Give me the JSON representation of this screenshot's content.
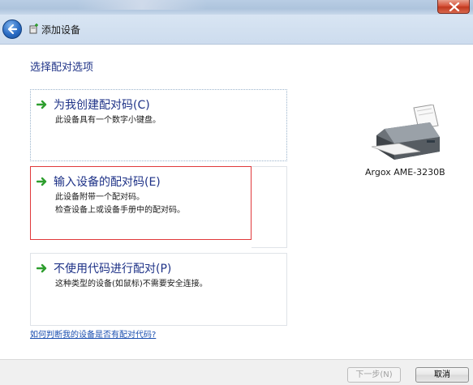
{
  "window": {
    "header_title": "添加设备"
  },
  "content": {
    "section_title": "选择配对选项",
    "options": [
      {
        "title": "为我创建配对码(C)",
        "desc_lines": [
          "此设备具有一个数字小键盘。"
        ]
      },
      {
        "title": "输入设备的配对码(E)",
        "desc_lines": [
          "此设备附带一个配对码。",
          "检查设备上或设备手册中的配对码。"
        ]
      },
      {
        "title": "不使用代码进行配对(P)",
        "desc_lines": [
          "这种类型的设备(如鼠标)不需要安全连接。"
        ]
      }
    ],
    "help_link": "如何判断我的设备是否有配对代码?"
  },
  "device": {
    "name": "Argox AME-3230B",
    "icon": "printer-icon"
  },
  "footer": {
    "next_label": "下一步(N)",
    "cancel_label": "取消"
  },
  "colors": {
    "title_blue": "#1e3287",
    "arrow_green": "#2e9e2e",
    "selection_red": "#e0393b",
    "link_blue": "#1a4fb0"
  }
}
